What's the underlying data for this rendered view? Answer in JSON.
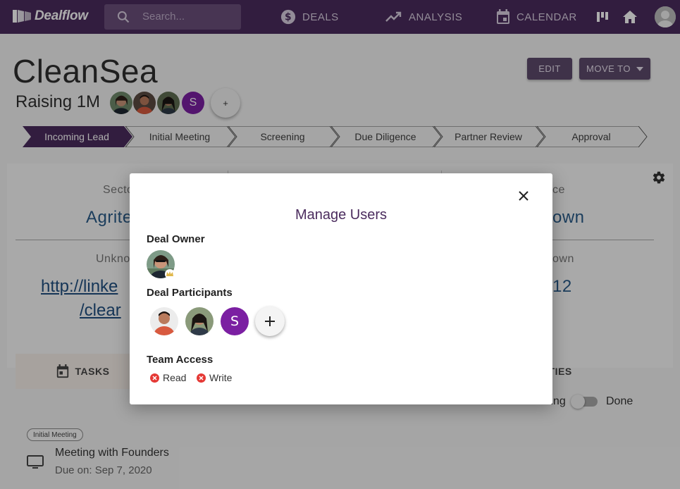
{
  "app": {
    "logo_text": "Dealflow"
  },
  "topbar": {
    "search_placeholder": "Search...",
    "nav": [
      {
        "label": "DEALS",
        "icon": "dollar-icon"
      },
      {
        "label": "ANALYSIS",
        "icon": "trending-up-icon"
      },
      {
        "label": "CALENDAR",
        "icon": "calendar-icon"
      }
    ]
  },
  "deal": {
    "name": "CleanSea",
    "raising": "Raising 1M",
    "participant_initial": "S",
    "add_label": "+",
    "edit_label": "EDIT",
    "move_label": "MOVE TO"
  },
  "stages": [
    {
      "label": "Incoming Lead",
      "active": true
    },
    {
      "label": "Initial Meeting",
      "active": false
    },
    {
      "label": "Screening",
      "active": false
    },
    {
      "label": "Due Diligence",
      "active": false
    },
    {
      "label": "Partner Review",
      "active": false
    },
    {
      "label": "Approval",
      "active": false
    }
  ],
  "details": {
    "sector_label": "Secto",
    "sector_value": "Agrite",
    "source_label": "ce",
    "source_value": "own",
    "unknown_label": "Unkno",
    "unknown_label_right": "own",
    "link_line1": "http://linke",
    "link_line2": "/clear",
    "right_value": "12"
  },
  "tabs": {
    "tasks": "TASKS",
    "activities": "IVITIES"
  },
  "filter": {
    "pending": "Pending",
    "done": "Done"
  },
  "task": {
    "chip": "Initial Meeting",
    "title": "Meeting with Founders",
    "due": "Due on: Sep 7, 2020"
  },
  "modal": {
    "title": "Manage Users",
    "owner_heading": "Deal Owner",
    "participants_heading": "Deal Participants",
    "participant_initial": "S",
    "team_heading": "Team Access",
    "access": [
      {
        "label": "Read"
      },
      {
        "label": "Write"
      }
    ]
  },
  "colors": {
    "brand": "#4b2c5e",
    "participant_avatar": "#7b1fa2",
    "access_denied": "#e53935",
    "link": "#2a5c8a"
  }
}
